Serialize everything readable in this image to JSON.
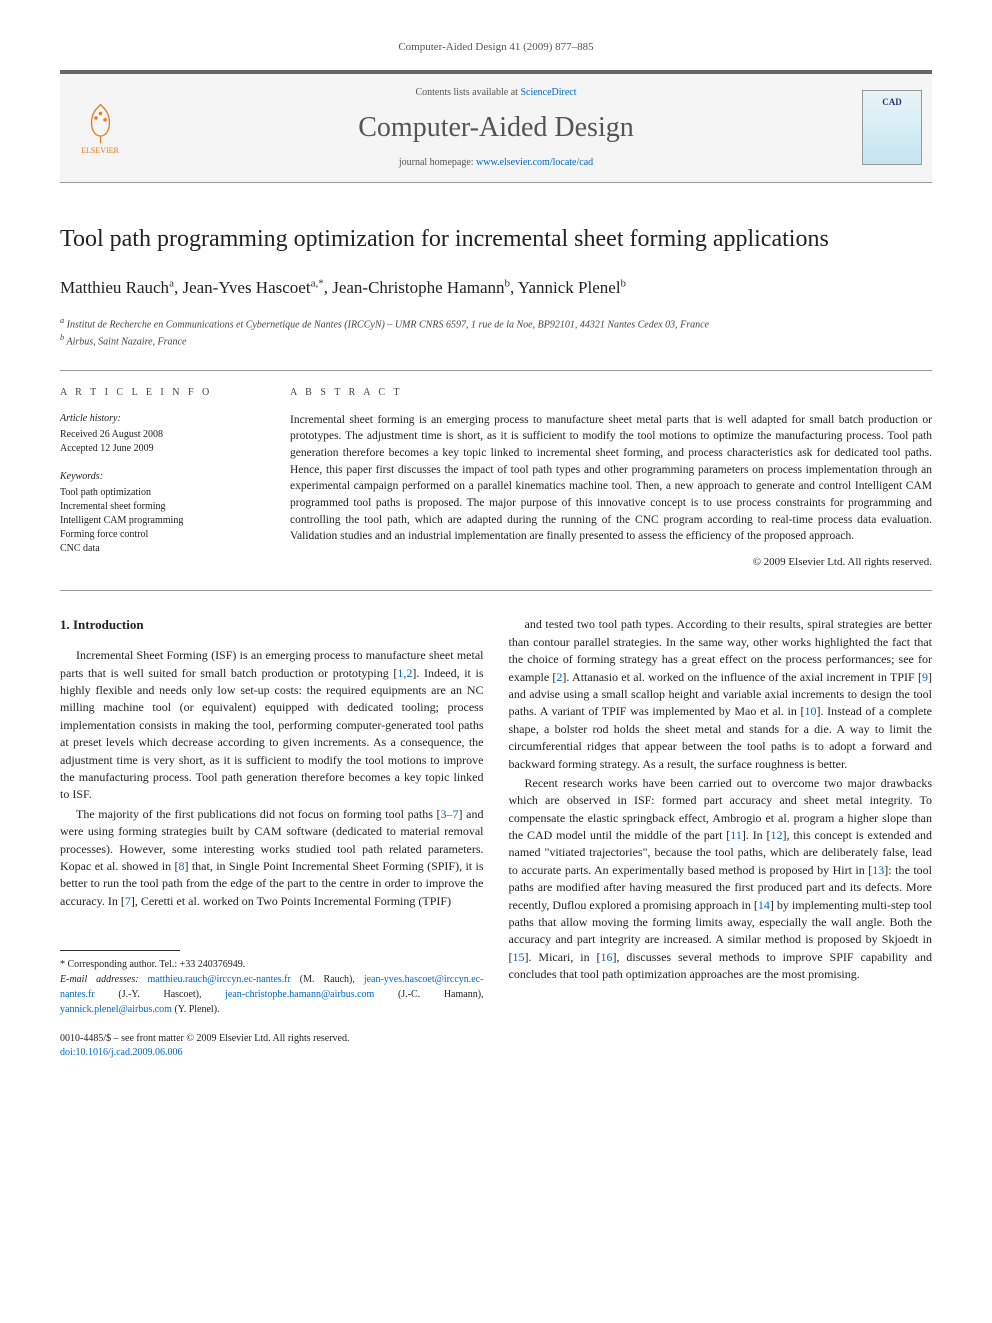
{
  "header": {
    "citation": "Computer-Aided Design 41 (2009) 877–885",
    "contents_prefix": "Contents lists available at ",
    "contents_link": "ScienceDirect",
    "journal_name": "Computer-Aided Design",
    "homepage_prefix": "journal homepage: ",
    "homepage_link": "www.elsevier.com/locate/cad",
    "publisher_name": "ELSEVIER",
    "cover_label": "CAD"
  },
  "title": "Tool path programming optimization for incremental sheet forming applications",
  "authors": [
    {
      "name": "Matthieu Rauch",
      "markers": "a"
    },
    {
      "name": "Jean-Yves Hascoet",
      "markers": "a,*"
    },
    {
      "name": "Jean-Christophe Hamann",
      "markers": "b"
    },
    {
      "name": "Yannick Plenel",
      "markers": "b"
    }
  ],
  "affiliations": {
    "a": "Institut de Recherche en Communications et Cybernetique de Nantes (IRCCyN) – UMR CNRS 6597, 1 rue de la Noe, BP92101, 44321 Nantes Cedex 03, France",
    "b": "Airbus, Saint Nazaire, France"
  },
  "article_info": {
    "label": "A R T I C L E   I N F O",
    "history_label": "Article history:",
    "received": "Received 26 August 2008",
    "accepted": "Accepted 12 June 2009",
    "keywords_label": "Keywords:",
    "keywords": [
      "Tool path optimization",
      "Incremental sheet forming",
      "Intelligent CAM programming",
      "Forming force control",
      "CNC data"
    ]
  },
  "abstract": {
    "label": "A B S T R A C T",
    "text": "Incremental sheet forming is an emerging process to manufacture sheet metal parts that is well adapted for small batch production or prototypes. The adjustment time is short, as it is sufficient to modify the tool motions to optimize the manufacturing process. Tool path generation therefore becomes a key topic linked to incremental sheet forming, and process characteristics ask for dedicated tool paths. Hence, this paper first discusses the impact of tool path types and other programming parameters on process implementation through an experimental campaign performed on a parallel kinematics machine tool. Then, a new approach to generate and control Intelligent CAM programmed tool paths is proposed. The major purpose of this innovative concept is to use process constraints for programming and controlling the tool path, which are adapted during the running of the CNC program according to real-time process data evaluation. Validation studies and an industrial implementation are finally presented to assess the efficiency of the proposed approach.",
    "copyright": "© 2009 Elsevier Ltd. All rights reserved."
  },
  "body": {
    "section_heading": "1. Introduction",
    "col1_p1": "Incremental Sheet Forming (ISF) is an emerging process to manufacture sheet metal parts that is well suited for small batch production or prototyping [1,2]. Indeed, it is highly flexible and needs only low set-up costs: the required equipments are an NC milling machine tool (or equivalent) equipped with dedicated tooling; process implementation consists in making the tool, performing computer-generated tool paths at preset levels which decrease according to given increments. As a consequence, the adjustment time is very short, as it is sufficient to modify the tool motions to improve the manufacturing process. Tool path generation therefore becomes a key topic linked to ISF.",
    "col1_p2": "The majority of the first publications did not focus on forming tool paths [3–7] and were using forming strategies built by CAM software (dedicated to material removal processes). However, some interesting works studied tool path related parameters. Kopac et al. showed in [8] that, in Single Point Incremental Sheet Forming (SPIF), it is better to run the tool path from the edge of the part to the centre in order to improve the accuracy. In [7], Ceretti et al. worked on Two Points Incremental Forming (TPIF)",
    "col2_p1": "and tested two tool path types. According to their results, spiral strategies are better than contour parallel strategies. In the same way, other works highlighted the fact that the choice of forming strategy has a great effect on the process performances; see for example [2]. Attanasio et al. worked on the influence of the axial increment in TPIF [9] and advise using a small scallop height and variable axial increments to design the tool paths. A variant of TPIF was implemented by Mao et al. in [10]. Instead of a complete shape, a bolster rod holds the sheet metal and stands for a die. A way to limit the circumferential ridges that appear between the tool paths is to adopt a forward and backward forming strategy. As a result, the surface roughness is better.",
    "col2_p2": "Recent research works have been carried out to overcome two major drawbacks which are observed in ISF: formed part accuracy and sheet metal integrity. To compensate the elastic springback effect, Ambrogio et al. program a higher slope than the CAD model until the middle of the part [11]. In [12], this concept is extended and named \"vitiated trajectories\", because the tool paths, which are deliberately false, lead to accurate parts. An experimentally based method is proposed by Hirt in [13]: the tool paths are modified after having measured the first produced part and its defects. More recently, Duflou explored a promising approach in [14] by implementing multi-step tool paths that allow moving the forming limits away, especially the wall angle. Both the accuracy and part integrity are increased. A similar method is proposed by Skjoedt in [15]. Micari, in [16], discusses several methods to improve SPIF capability and concludes that tool path optimization approaches are the most promising."
  },
  "footer": {
    "corresponding": "Corresponding author. Tel.: +33 240376949.",
    "email_label": "E-mail addresses:",
    "emails": [
      {
        "addr": "matthieu.rauch@irccyn.ec-nantes.fr",
        "who": "(M. Rauch)"
      },
      {
        "addr": "jean-yves.hascoet@irccyn.ec-nantes.fr",
        "who": "(J.-Y. Hascoet)"
      },
      {
        "addr": "jean-christophe.hamann@airbus.com",
        "who": "(J.-C. Hamann)"
      },
      {
        "addr": "yannick.plenel@airbus.com",
        "who": "(Y. Plenel)"
      }
    ],
    "issn_line": "0010-4485/$ – see front matter © 2009 Elsevier Ltd. All rights reserved.",
    "doi": "doi:10.1016/j.cad.2009.06.006"
  }
}
